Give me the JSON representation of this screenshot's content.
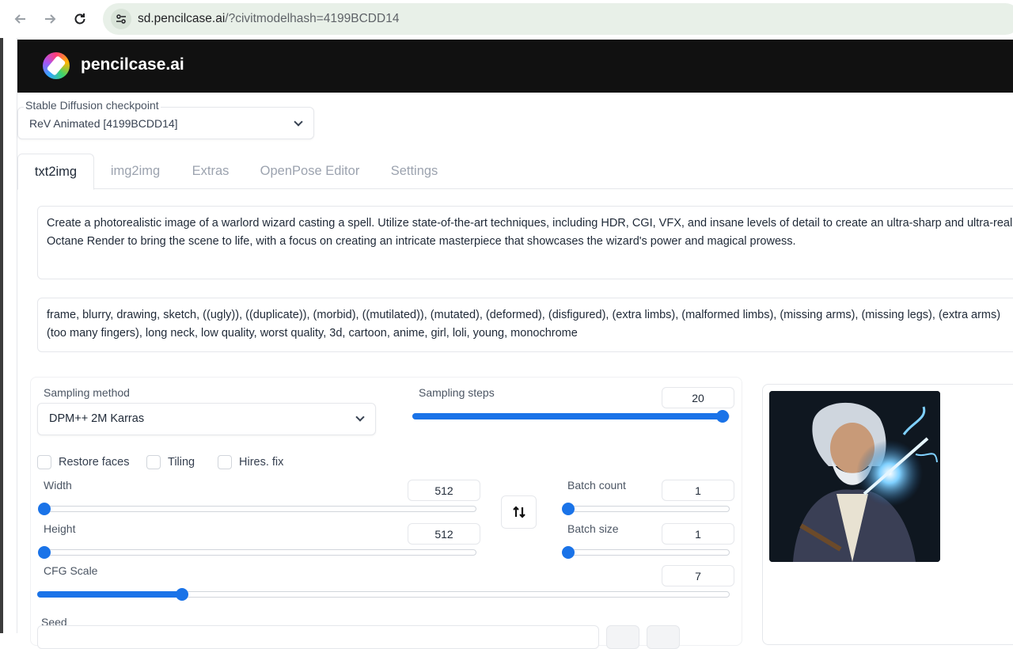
{
  "browser": {
    "url_domain": "sd.pencilcase.ai",
    "url_path": "/?civitmodelhash=4199BCDD14"
  },
  "header": {
    "brand": "pencilcase.ai"
  },
  "checkpoint": {
    "label": "Stable Diffusion checkpoint",
    "value": "ReV Animated [4199BCDD14]"
  },
  "tabs": [
    {
      "label": "txt2img",
      "active": true
    },
    {
      "label": "img2img",
      "active": false
    },
    {
      "label": "Extras",
      "active": false
    },
    {
      "label": "OpenPose Editor",
      "active": false
    },
    {
      "label": "Settings",
      "active": false
    }
  ],
  "prompt": {
    "line1": "Create a photorealistic image of a warlord wizard casting a spell. Utilize state-of-the-art techniques, including HDR, CGI, VFX, and insane levels of detail to create an ultra-sharp and ultra-reali",
    "line2": "Octane Render to bring the scene to life, with a focus on creating an intricate masterpiece that showcases the wizard's power and magical prowess."
  },
  "negative_prompt": {
    "line1": "frame, blurry, drawing, sketch, ((ugly)), ((duplicate)), (morbid), ((mutilated)), (mutated), (deformed), (disfigured), (extra limbs), (malformed limbs), (missing arms), (missing legs), (extra arms)",
    "line2": "(too many fingers), long neck, low quality, worst quality, 3d, cartoon, anime, girl, loli, young, monochrome"
  },
  "sampling_method": {
    "label": "Sampling method",
    "value": "DPM++ 2M Karras"
  },
  "sampling_steps": {
    "label": "Sampling steps",
    "value": "20",
    "fraction": 1.0
  },
  "checkboxes": [
    {
      "label": "Restore faces",
      "checked": false
    },
    {
      "label": "Tiling",
      "checked": false
    },
    {
      "label": "Hires. fix",
      "checked": false
    }
  ],
  "width": {
    "label": "Width",
    "value": "512",
    "fraction": 0.0
  },
  "height": {
    "label": "Height",
    "value": "512",
    "fraction": 0.0
  },
  "batch_count": {
    "label": "Batch count",
    "value": "1",
    "fraction": 0.0
  },
  "batch_size": {
    "label": "Batch size",
    "value": "1",
    "fraction": 0.0
  },
  "cfg_scale": {
    "label": "CFG Scale",
    "value": "7",
    "fraction": 0.21
  },
  "seed": {
    "label": "Seed"
  },
  "colors": {
    "accent": "#1a73e8",
    "header_bg": "#111111"
  },
  "icons": {
    "back": "arrow-left-icon",
    "forward": "arrow-right-icon",
    "reload": "reload-icon",
    "site_info": "site-info-icon",
    "swap": "swap-vertical-icon"
  }
}
